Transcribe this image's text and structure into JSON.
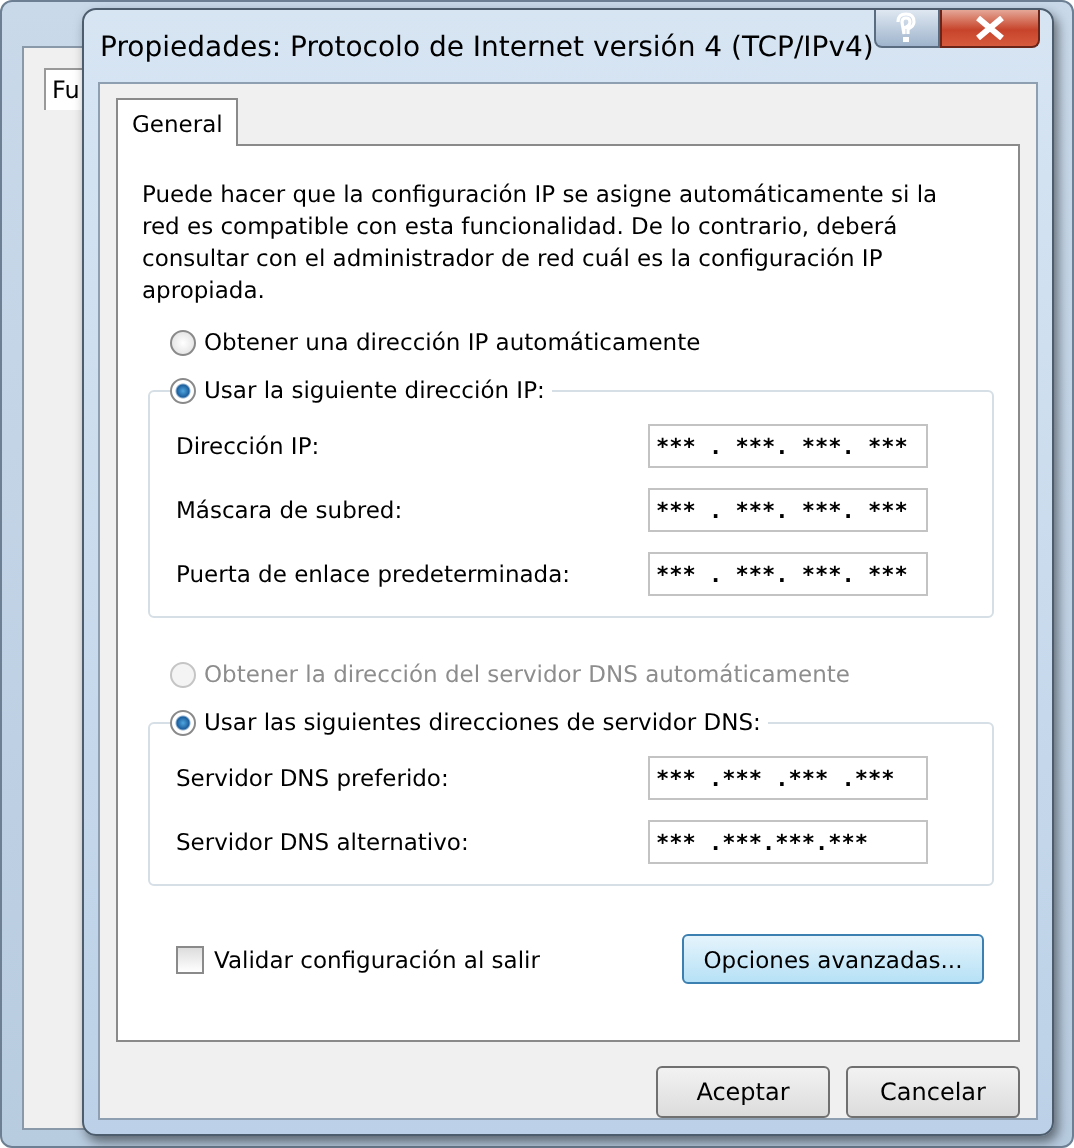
{
  "background_window": {
    "tab": "Fu"
  },
  "window": {
    "title": "Propiedades: Protocolo de Internet versión 4 (TCP/IPv4)"
  },
  "tabs": [
    {
      "label": "General",
      "selected": true
    }
  ],
  "description": "Puede hacer que la configuración IP se asigne automáticamente si la red es compatible con esta funcionalidad. De lo contrario, deberá consultar con el administrador de red cuál es la configuración IP apropiada.",
  "ip_options": [
    {
      "label": "Obtener una dirección IP automáticamente",
      "selected": false,
      "disabled": false
    },
    {
      "label": "Usar la siguiente dirección IP:",
      "selected": true,
      "disabled": false
    }
  ],
  "ip_fields": [
    {
      "label": "Dirección IP:",
      "value": "*** . ***. ***. ***"
    },
    {
      "label": "Máscara de subred:",
      "value": "*** . ***. ***. ***"
    },
    {
      "label": "Puerta de enlace predeterminada:",
      "value": "*** . ***. ***. ***"
    }
  ],
  "dns_options": [
    {
      "label": "Obtener la dirección del servidor DNS automáticamente",
      "selected": false,
      "disabled": true
    },
    {
      "label": "Usar las siguientes direcciones de servidor DNS:",
      "selected": true,
      "disabled": false
    }
  ],
  "dns_fields": [
    {
      "label": "Servidor DNS preferido:",
      "value": "*** .*** .*** .***"
    },
    {
      "label": "Servidor DNS alternativo:",
      "value": "*** .***.***.***"
    }
  ],
  "validate": {
    "label": "Validar configuración al salir",
    "checked": false
  },
  "advanced_button": "Opciones avanzadas...",
  "buttons": [
    "Aceptar",
    "Cancelar"
  ]
}
